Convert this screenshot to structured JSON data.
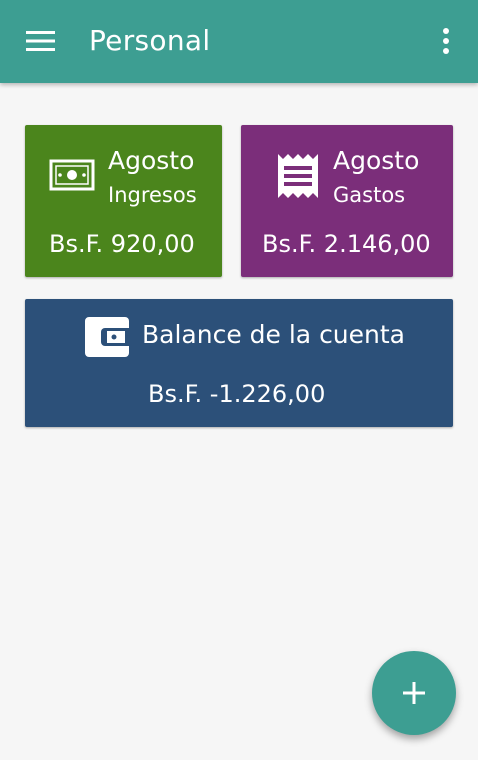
{
  "appbar": {
    "title": "Personal",
    "background_color": "#3d9e92",
    "menu_icon": "hamburger-menu-icon",
    "overflow_icon": "more-vert-icon"
  },
  "cards": {
    "income": {
      "month": "Agosto",
      "type": "Ingresos",
      "amount": "Bs.F. 920,00",
      "color": "#4b851c",
      "icon": "cash-bill-icon"
    },
    "expense": {
      "month": "Agosto",
      "type": "Gastos",
      "amount": "Bs.F. 2.146,00",
      "color": "#7b2e7a",
      "icon": "receipt-icon"
    },
    "balance": {
      "heading": "Balance de la cuenta",
      "amount": "Bs.F. -1.226,00",
      "color": "#2c5079",
      "icon": "wallet-icon"
    }
  },
  "fab": {
    "icon": "add-icon",
    "color": "#3d9e92"
  }
}
